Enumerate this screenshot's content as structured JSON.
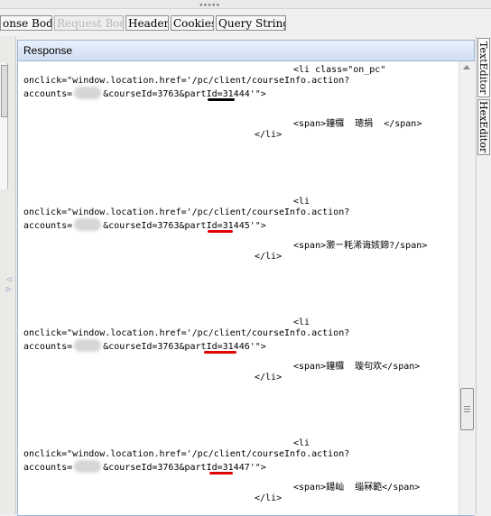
{
  "tabs": [
    {
      "label": "onse Body",
      "state": "normal"
    },
    {
      "label": "Request Body",
      "state": "disabled"
    },
    {
      "label": "Headers",
      "state": "normal"
    },
    {
      "label": "Cookies",
      "state": "normal"
    },
    {
      "label": "Query String",
      "state": "normal"
    }
  ],
  "panel": {
    "title": "Response"
  },
  "side_tabs": [
    "TextEditor",
    "HexEditor"
  ],
  "code": {
    "li_open_class": "<li class=\"on_pc\"",
    "li_open": "<li",
    "onclick": "onclick=\"window.location.href='/pc/client/courseInfo.action?",
    "accounts_prefix": "accounts=",
    "course_params": "&courseId=3763&partId=",
    "url_end": "'\">",
    "li_close": "</li>",
    "entries": [
      {
        "part_id": "31444",
        "span_text": "<span>鐘欏  璁捐  </span>"
      },
      {
        "part_id": "31445",
        "span_text": "<span>灏ㄧ粍浠诲姟鍗?/span>"
      },
      {
        "part_id": "31446",
        "span_text": "<span>鐘欏  璇句欢</span>"
      },
      {
        "part_id": "31447",
        "span_text": "<span>鍚屾  缁冧範</span>"
      }
    ]
  },
  "colors": {
    "underline_black": "#000000",
    "underline_red": "#e00000",
    "panel_border": "#9fb6d3"
  }
}
